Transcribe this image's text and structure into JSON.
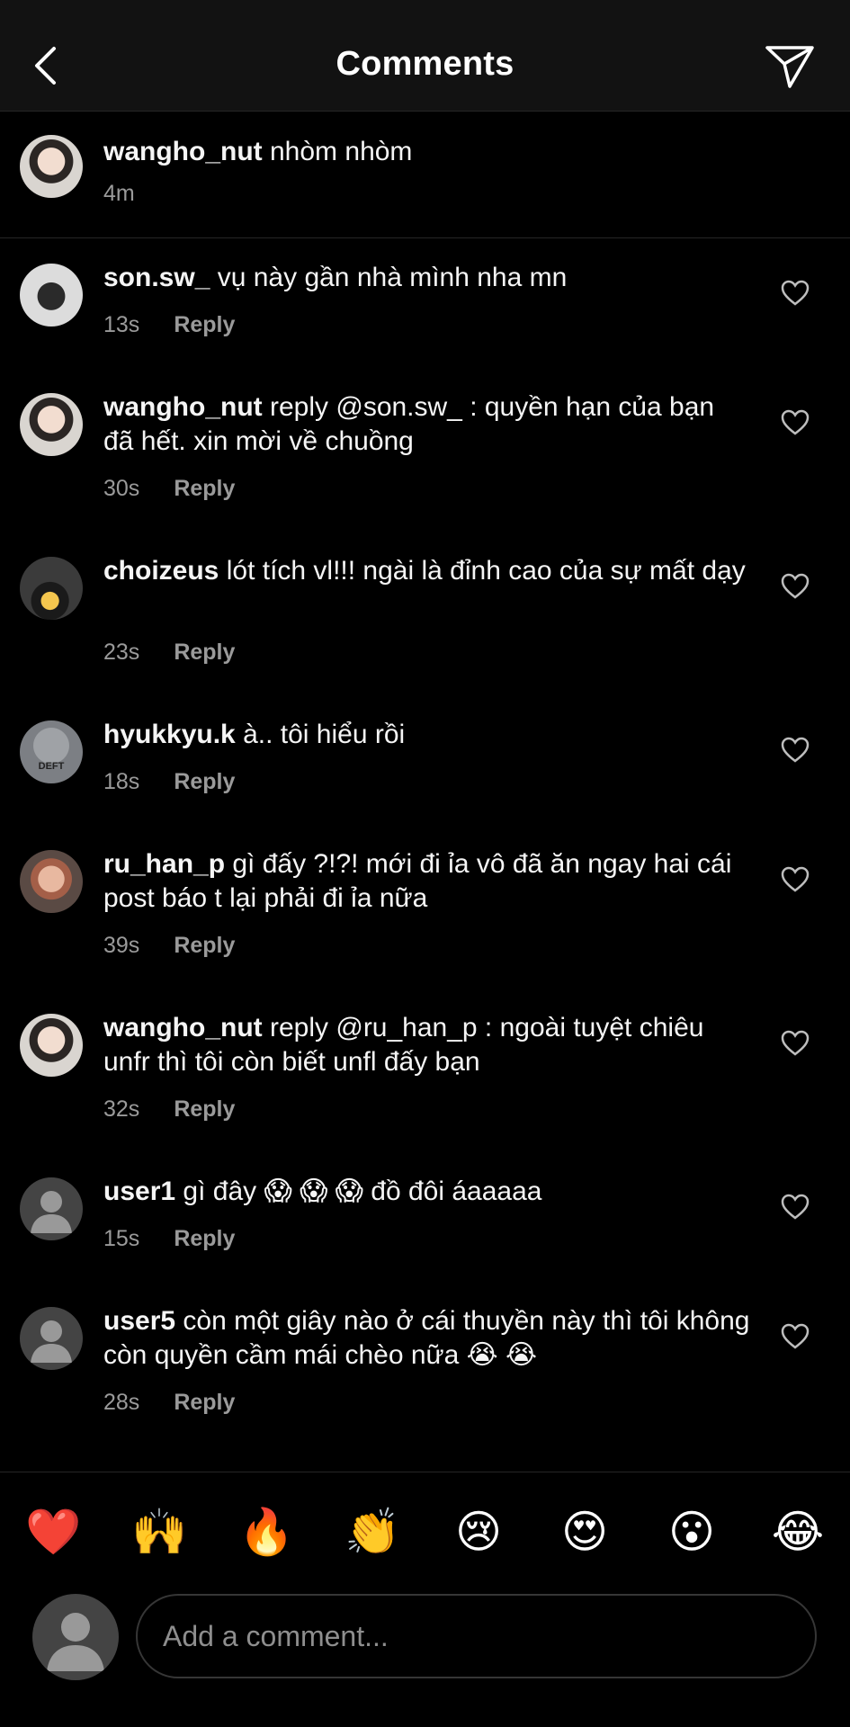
{
  "header": {
    "title": "Comments",
    "back_icon": "chevron-left-icon",
    "send_icon": "paper-plane-icon"
  },
  "caption": {
    "username": "wangho_nut",
    "text": "nhòm nhòm",
    "time": "4m"
  },
  "comments": [
    {
      "username": "son.sw_",
      "text": "vụ này gần nhà mình nha mn",
      "time": "13s",
      "reply": "Reply",
      "avatar": "photo"
    },
    {
      "username": "wangho_nut",
      "text": "reply @son.sw_ : quyền hạn của bạn đã hết. xin mời về chuồng",
      "time": "30s",
      "reply": "Reply",
      "avatar": "photo"
    },
    {
      "username": "choizeus",
      "text": "lót tích vl!!! ngài là đỉnh cao của sự mất dạy",
      "time": "23s",
      "reply": "Reply",
      "avatar": "photo"
    },
    {
      "username": "hyukkyu.k",
      "text": "à.. tôi hiểu rồi",
      "time": "18s",
      "reply": "Reply",
      "avatar": "photo",
      "avatar_text": "DEFT"
    },
    {
      "username": "ru_han_p",
      "text": "gì đấy ?!?! mới đi ỉa vô đã ăn ngay hai cái post báo t lại phải đi ỉa nữa",
      "time": "39s",
      "reply": "Reply",
      "avatar": "photo"
    },
    {
      "username": "wangho_nut",
      "text": "reply @ru_han_p : ngoài tuyệt chiêu unfr thì tôi còn biết unfl đấy bạn",
      "time": "32s",
      "reply": "Reply",
      "avatar": "photo"
    },
    {
      "username": "user1",
      "text": "gì đây 😱 😱 😱  đồ đôi áaaaaa",
      "time": "15s",
      "reply": "Reply",
      "avatar": "default"
    },
    {
      "username": "user5",
      "text": "còn một giây nào ở cái thuyền này thì tôi không còn quyền cầm mái chèo nữa 😭 😭",
      "time": "28s",
      "reply": "Reply",
      "avatar": "default"
    }
  ],
  "emoji_reactions": [
    "❤️",
    "🙌",
    "🔥",
    "👏",
    "😢",
    "😍",
    "😮",
    "😂"
  ],
  "composer": {
    "placeholder": "Add a comment..."
  }
}
